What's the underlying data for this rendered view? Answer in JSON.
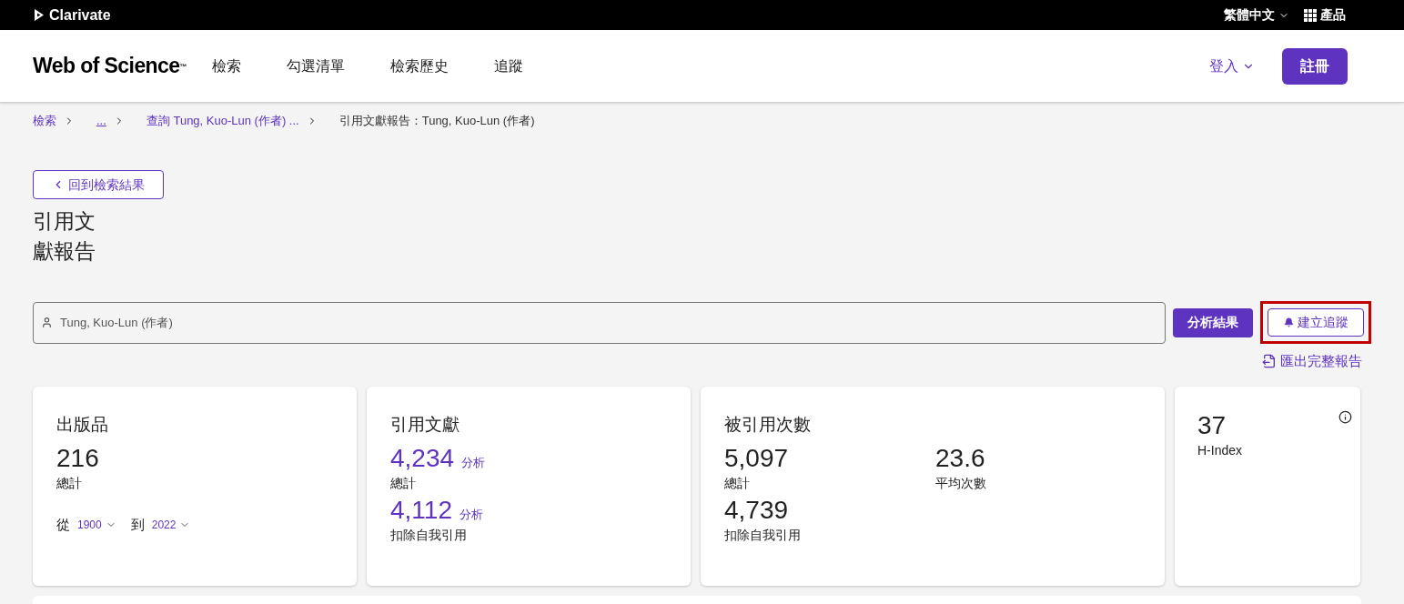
{
  "top_bar": {
    "brand": "Clarivate",
    "language": "繁體中文",
    "products": "產品"
  },
  "header": {
    "logo": "Web of Science",
    "logo_mark": "™",
    "nav": [
      "檢索",
      "勾選清單",
      "檢索歷史",
      "追蹤"
    ],
    "login": "登入",
    "register": "註冊"
  },
  "breadcrumb": [
    {
      "label": "檢索",
      "kind": "link"
    },
    {
      "label": "...",
      "kind": "ellipsis"
    },
    {
      "label": "查詢 Tung, Kuo-Lun (作者) ...",
      "kind": "link"
    },
    {
      "label": "引用文獻報告：Tung, Kuo-Lun (作者)",
      "kind": "current"
    }
  ],
  "back_button": "回到檢索結果",
  "title": "引用文獻報告",
  "search": {
    "value": "Tung, Kuo-Lun (作者)"
  },
  "analyze_button": "分析結果",
  "track_button": {
    "label": "建立追蹤",
    "highlighted": true
  },
  "export_link": "匯出完整報告",
  "publications": {
    "title": "出版品",
    "total": "216",
    "total_label": "總計",
    "from_label": "從",
    "from_value": "1900",
    "to_label": "到",
    "to_value": "2022"
  },
  "citing": {
    "title": "引用文獻",
    "rows": [
      {
        "value": "4,234",
        "link": "分析",
        "label": "總計"
      },
      {
        "value": "4,112",
        "link": "分析",
        "label": "扣除自我引用"
      }
    ]
  },
  "times_cited": {
    "title": "被引用次數",
    "total": "5,097",
    "total_label": "總計",
    "average": "23.6",
    "average_label": "平均次數",
    "without_self": "4,739",
    "without_self_label": "扣除自我引用"
  },
  "h_index": {
    "value": "37",
    "label": "H-Index"
  }
}
